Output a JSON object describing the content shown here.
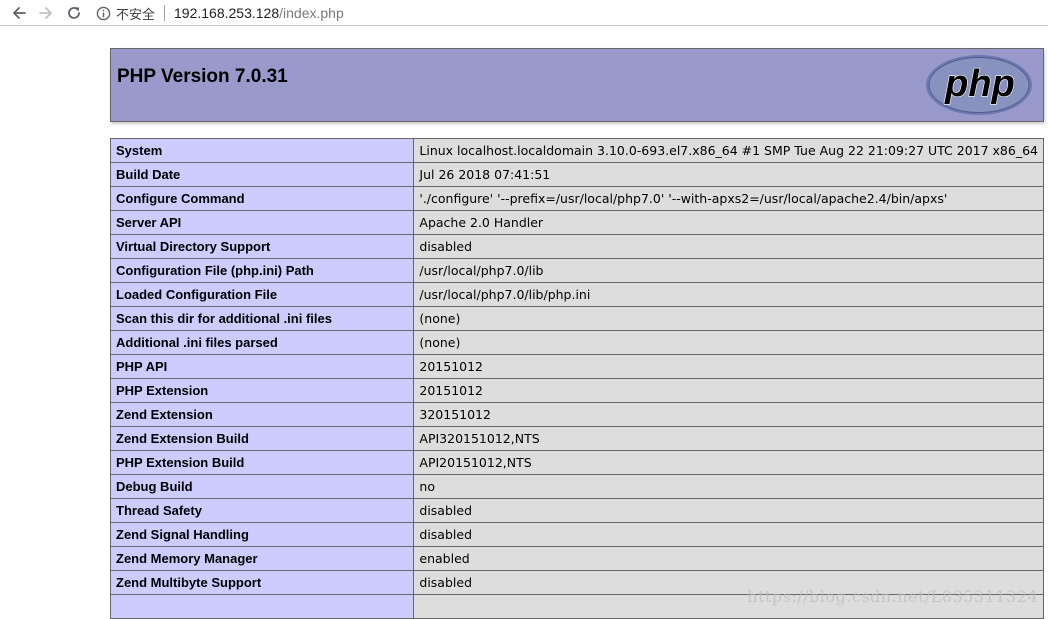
{
  "browser": {
    "security_label": "不安全",
    "url_host": "192.168.253.128",
    "url_path": "/index.php"
  },
  "header": {
    "title": "PHP Version 7.0.31",
    "logo_text": "php"
  },
  "rows": [
    {
      "key": "System",
      "value": "Linux localhost.localdomain 3.10.0-693.el7.x86_64 #1 SMP Tue Aug 22 21:09:27 UTC 2017 x86_64"
    },
    {
      "key": "Build Date",
      "value": "Jul 26 2018 07:41:51"
    },
    {
      "key": "Configure Command",
      "value": "'./configure' '--prefix=/usr/local/php7.0' '--with-apxs2=/usr/local/apache2.4/bin/apxs'"
    },
    {
      "key": "Server API",
      "value": "Apache 2.0 Handler"
    },
    {
      "key": "Virtual Directory Support",
      "value": "disabled"
    },
    {
      "key": "Configuration File (php.ini) Path",
      "value": "/usr/local/php7.0/lib"
    },
    {
      "key": "Loaded Configuration File",
      "value": "/usr/local/php7.0/lib/php.ini"
    },
    {
      "key": "Scan this dir for additional .ini files",
      "value": "(none)"
    },
    {
      "key": "Additional .ini files parsed",
      "value": "(none)"
    },
    {
      "key": "PHP API",
      "value": "20151012"
    },
    {
      "key": "PHP Extension",
      "value": "20151012"
    },
    {
      "key": "Zend Extension",
      "value": "320151012"
    },
    {
      "key": "Zend Extension Build",
      "value": "API320151012,NTS"
    },
    {
      "key": "PHP Extension Build",
      "value": "API20151012,NTS"
    },
    {
      "key": "Debug Build",
      "value": "no"
    },
    {
      "key": "Thread Safety",
      "value": "disabled"
    },
    {
      "key": "Zend Signal Handling",
      "value": "disabled"
    },
    {
      "key": "Zend Memory Manager",
      "value": "enabled"
    },
    {
      "key": "Zend Multibyte Support",
      "value": "disabled"
    },
    {
      "key": "",
      "value": ""
    }
  ],
  "watermark": "https://blog.csdn.net/L835311324"
}
